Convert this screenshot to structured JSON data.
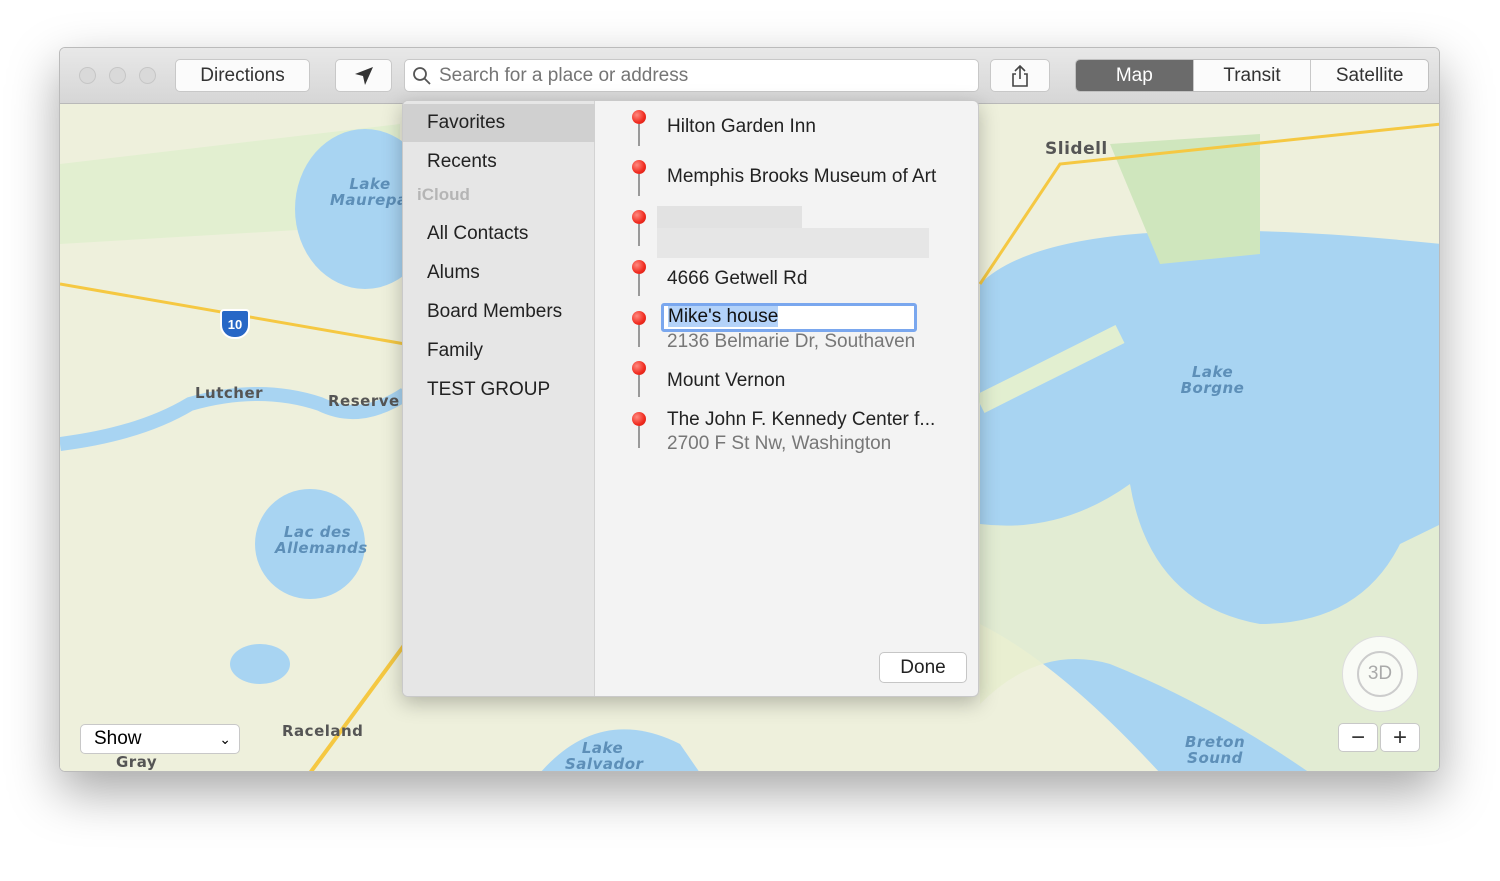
{
  "toolbar": {
    "directions": "Directions",
    "search_placeholder": "Search for a place or address",
    "map_types": [
      "Map",
      "Transit",
      "Satellite"
    ],
    "selected_map_type": "Map"
  },
  "sidebar": {
    "items": [
      {
        "label": "Favorites",
        "selected": true
      },
      {
        "label": "Recents"
      }
    ],
    "section": "iCloud",
    "groups": [
      "All Contacts",
      "Alums",
      "Board Members",
      "Family",
      "TEST GROUP"
    ]
  },
  "favorites": [
    {
      "name": "Hilton Garden Inn"
    },
    {
      "name": "Memphis Brooks Museum of Art"
    },
    {
      "name": "",
      "redacted": true
    },
    {
      "name": "4666 Getwell Rd"
    },
    {
      "name": "Mike's house",
      "address": "2136 Belmarie Dr, Southaven",
      "editing": true
    },
    {
      "name": "Mount Vernon"
    },
    {
      "name": "The John F. Kennedy Center f...",
      "address": "2700 F St Nw, Washington"
    }
  ],
  "done_label": "Done",
  "map": {
    "show_label": "Show",
    "compass_label": "3D",
    "zoom_out": "−",
    "zoom_in": "+",
    "labels": {
      "lake_maurepas": "Lake Maurepas",
      "lutcher": "Lutcher",
      "reserve": "Reserve",
      "lac_des_allemands": "Lac des Allemands",
      "raceland": "Raceland",
      "gray": "Gray",
      "slidell": "Slidell",
      "lake_borgne": "Lake Borgne",
      "breton_sound": "Breton Sound",
      "lake_salvador": "Lake Salvador",
      "interstate": "10"
    }
  },
  "colors": {
    "pin": "#f02a1e",
    "water": "#a8d4f2",
    "land": "#eef0dc",
    "selected_segment": "#6b6b6b",
    "highlight": "#7aa7ee"
  }
}
